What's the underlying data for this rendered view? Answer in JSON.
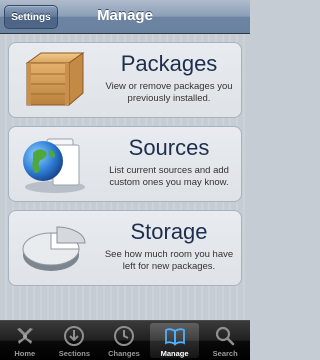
{
  "navbar": {
    "back_label": "Settings",
    "title": "Manage"
  },
  "cards": [
    {
      "title": "Packages",
      "description": "View or remove packages you previously installed.",
      "icon": "crate-icon"
    },
    {
      "title": "Sources",
      "description": "List current sources and add custom ones you may know.",
      "icon": "globe-icon"
    },
    {
      "title": "Storage",
      "description": "See how much room you have left for new packages.",
      "icon": "pie-chart-icon"
    }
  ],
  "tabs": [
    {
      "label": "Home",
      "icon": "cydia-home-icon",
      "active": false
    },
    {
      "label": "Sections",
      "icon": "sections-icon",
      "active": false
    },
    {
      "label": "Changes",
      "icon": "clock-icon",
      "active": false
    },
    {
      "label": "Manage",
      "icon": "book-icon",
      "active": true
    },
    {
      "label": "Search",
      "icon": "search-icon",
      "active": false
    }
  ],
  "colors": {
    "navbar": "#6d84a2",
    "title_text": "#1e2f4d",
    "tabbar": "#000000"
  }
}
